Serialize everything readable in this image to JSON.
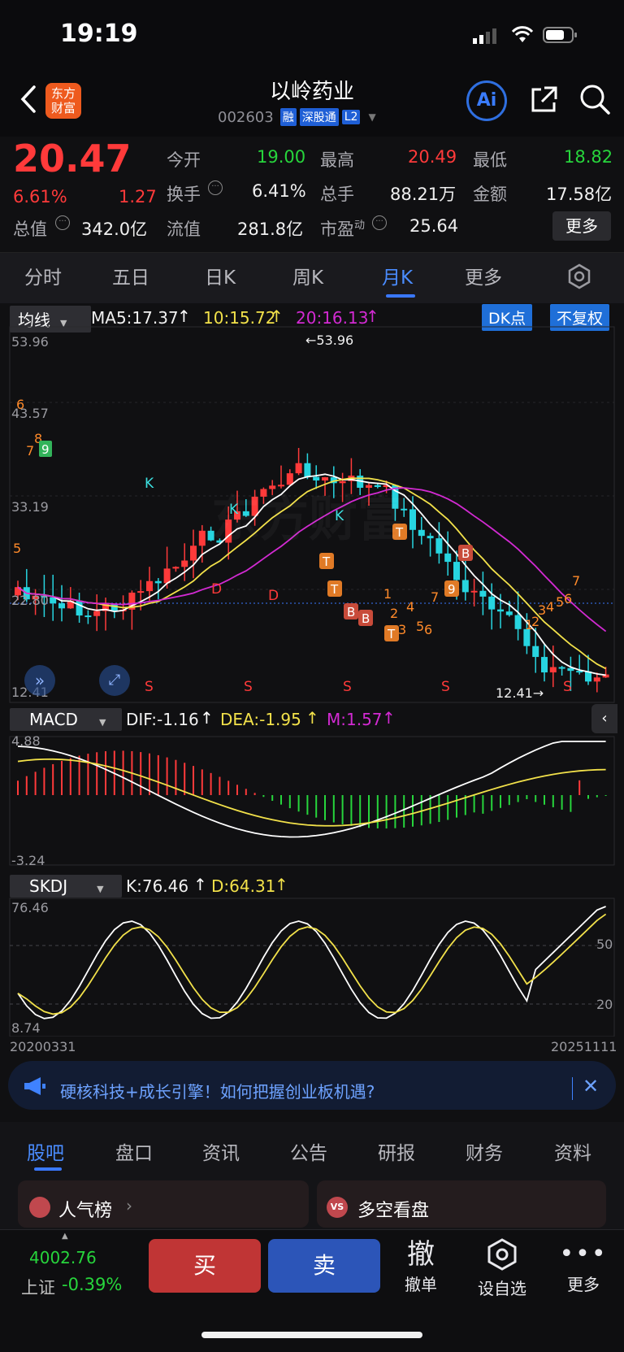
{
  "status": {
    "time": "19:19"
  },
  "header": {
    "logo_text": "东方财富",
    "title": "以岭药业",
    "code": "002603",
    "tags": [
      "融",
      "深股通",
      "L2"
    ],
    "ai_label": "Ai"
  },
  "quote": {
    "price": "20.47",
    "pct": "6.61%",
    "change": "1.27",
    "open_label": "今开",
    "open": "19.00",
    "high_label": "最高",
    "high": "20.49",
    "low_label": "最低",
    "low": "18.82",
    "turnover_label": "换手",
    "turnover": "6.41%",
    "volume_label": "总手",
    "volume": "88.21万",
    "amount_label": "金额",
    "amount": "17.58亿",
    "mktcap_label": "总值",
    "mktcap": "342.0亿",
    "float_label": "流值",
    "float": "281.8亿",
    "pe_label": "市盈",
    "pe_sup": "动",
    "pe": "25.64",
    "more": "更多"
  },
  "tabs": [
    {
      "label": "分时"
    },
    {
      "label": "五日"
    },
    {
      "label": "日K"
    },
    {
      "label": "周K"
    },
    {
      "label": "月K",
      "active": true
    },
    {
      "label": "更多"
    }
  ],
  "ma_bar": {
    "selector": "均线",
    "ma5": "MA5:17.37",
    "ma10": "10:15.72",
    "ma20": "20:16.13",
    "dk": "DK点",
    "adjust": "不复权"
  },
  "kline": {
    "y_labels": [
      "53.96",
      "43.57",
      "33.19",
      "22.80",
      "12.41"
    ],
    "max_label": "←53.96",
    "min_label": "12.41→"
  },
  "macd": {
    "selector": "MACD",
    "dif": "DIF:-1.16",
    "dea": "DEA:-1.95",
    "m": "M:1.57",
    "top": "4.88",
    "bottom": "-3.24"
  },
  "kdj": {
    "selector": "SKDJ",
    "k": "K:76.46",
    "d": "D:64.31",
    "top": "76.46",
    "bottom": "8.74",
    "l50": "50",
    "l20": "20",
    "date_start": "20200331",
    "date_end": "20251111"
  },
  "banner": {
    "text": "硬核科技+成长引擎！如何把握创业板机遇?"
  },
  "feed_tabs": [
    {
      "label": "股吧",
      "active": true
    },
    {
      "label": "盘口"
    },
    {
      "label": "资讯"
    },
    {
      "label": "公告"
    },
    {
      "label": "研报"
    },
    {
      "label": "财务"
    },
    {
      "label": "资料"
    }
  ],
  "cards": {
    "left": "人气榜",
    "right": "多空看盘",
    "right_badge": "VS"
  },
  "bottom": {
    "index_value": "4002.76",
    "index_name": "上证",
    "index_pct": "-0.39%",
    "buy": "买",
    "sell": "卖",
    "cancel_glyph": "撤",
    "cancel_label": "撤单",
    "watch_label": "设自选",
    "more_label": "更多"
  },
  "colors": {
    "up": "#ff3a3a",
    "down": "#27d5e0",
    "ma5": "#ffffff",
    "ma10": "#f2e14a",
    "ma20": "#d22ad2",
    "accent": "#3a78ff"
  }
}
